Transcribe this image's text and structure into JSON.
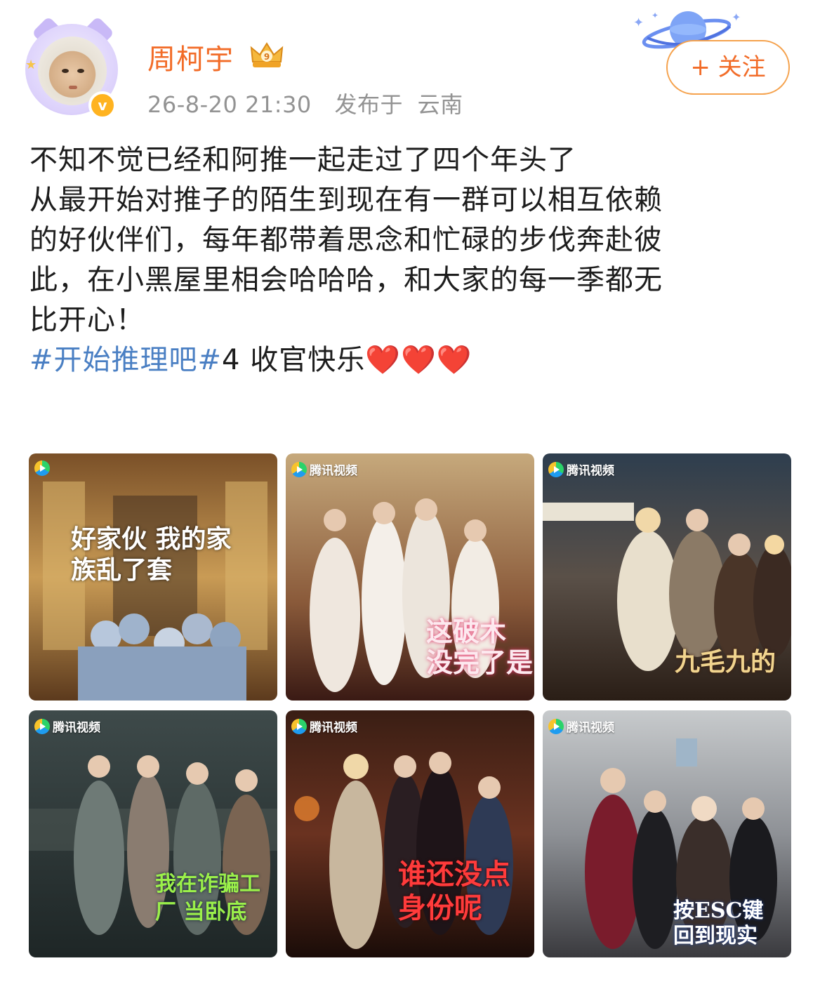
{
  "user": {
    "name": "周柯宇",
    "timestamp": "26-8-20 21:30",
    "location_prefix": "发布于",
    "location": "云南",
    "verified_mark": "v"
  },
  "follow_button": {
    "label": "+ 关注"
  },
  "post": {
    "lines": [
      "不知不觉已经和阿推一起走过了四个年头了",
      "从最开始对推子的陌生到现在有一群可以相互依赖",
      "的好伙伴们，每年都带着思念和忙碌的步伐奔赴彼",
      "此，在小黑屋里相会哈哈哈，和大家的每一季都无",
      "比开心！"
    ],
    "hashtag": "#开始推理吧#",
    "after_hashtag": "4 收官快乐",
    "hearts": [
      "❤️",
      "❤️",
      "❤️"
    ]
  },
  "images": [
    {
      "watermark": "",
      "caption": "好家伙 我的家族乱了套"
    },
    {
      "watermark": "腾讯视频",
      "caption": "这破木 没完了是"
    },
    {
      "watermark": "腾讯视频",
      "caption": "九毛九的"
    },
    {
      "watermark": "腾讯视频",
      "caption": "我在诈骗工厂 当卧底"
    },
    {
      "watermark": "腾讯视频",
      "caption": "谁还没点 身份呢"
    },
    {
      "watermark": "腾讯视频",
      "caption": "按ESC键 回到现实"
    }
  ],
  "colors": {
    "username": "#f26c28",
    "hashtag": "#4a7fc3",
    "meta": "#939393",
    "follow_border": "#f5a24d"
  }
}
